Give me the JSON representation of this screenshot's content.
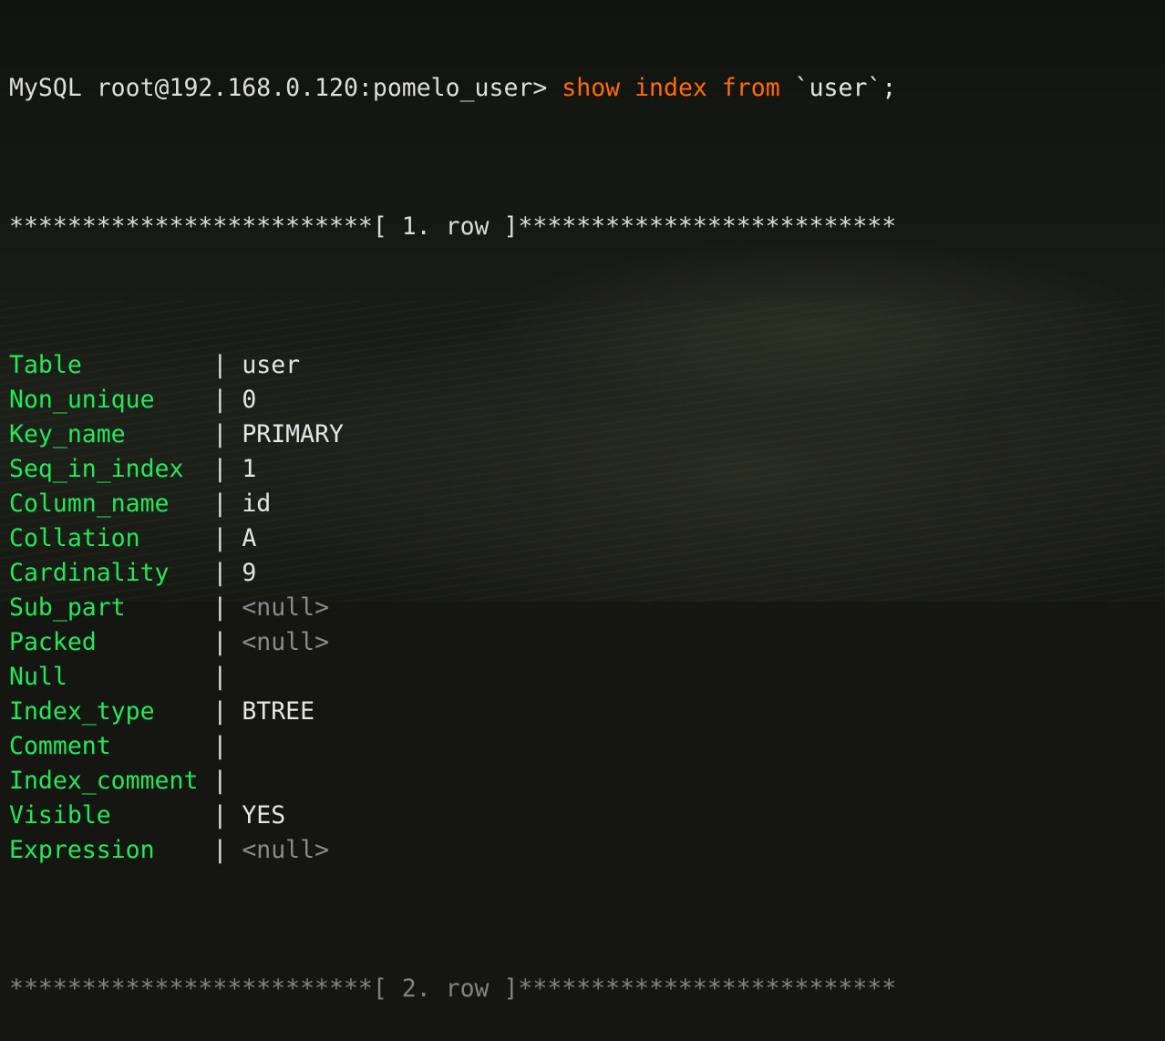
{
  "prompt": {
    "text": "MySQL root@192.168.0.120:pomelo_user>",
    "cmd_kw1": "show",
    "cmd_kw2": "index",
    "cmd_kw3": "from",
    "cmd_arg": "`user`;"
  },
  "row_header": {
    "stars_left": "*************************",
    "label": "[ 1. row ]",
    "stars_right": "**************************"
  },
  "separator": "|",
  "fields": [
    {
      "name": "Table",
      "value": "user"
    },
    {
      "name": "Non_unique",
      "value": "0"
    },
    {
      "name": "Key_name",
      "value": "PRIMARY"
    },
    {
      "name": "Seq_in_index",
      "value": "1"
    },
    {
      "name": "Column_name",
      "value": "id"
    },
    {
      "name": "Collation",
      "value": "A"
    },
    {
      "name": "Cardinality",
      "value": "9"
    },
    {
      "name": "Sub_part",
      "value": "<null>"
    },
    {
      "name": "Packed",
      "value": "<null>"
    },
    {
      "name": "Null",
      "value": ""
    },
    {
      "name": "Index_type",
      "value": "BTREE"
    },
    {
      "name": "Comment",
      "value": ""
    },
    {
      "name": "Index_comment",
      "value": ""
    },
    {
      "name": "Visible",
      "value": "YES"
    },
    {
      "name": "Expression",
      "value": "<null>"
    }
  ],
  "next_row_header": {
    "stars_left": "*************************",
    "label": "[ 2. row ]",
    "stars_right": "**************************"
  },
  "colors": {
    "field": "#23e85a",
    "keyword": "#ff6b00",
    "null": "#8a8a8a",
    "text": "#e6e6e6"
  }
}
